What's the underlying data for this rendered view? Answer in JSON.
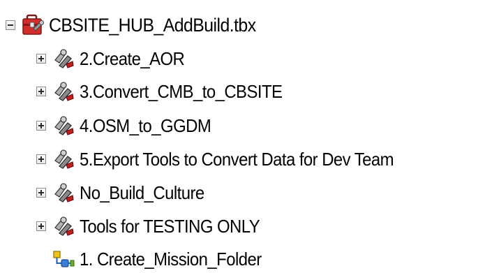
{
  "toolbox": {
    "name": "CBSITE_HUB_AddBuild.tbx",
    "expanded": true,
    "icon": "toolbox-icon"
  },
  "items": [
    {
      "label": "2.Create_AOR",
      "type": "toolset",
      "icon": "toolset-icon",
      "expander": "plus"
    },
    {
      "label": "3.Convert_CMB_to_CBSITE",
      "type": "toolset",
      "icon": "toolset-icon",
      "expander": "plus"
    },
    {
      "label": "4.OSM_to_GGDM",
      "type": "toolset",
      "icon": "toolset-icon",
      "expander": "plus"
    },
    {
      "label": "5.Export Tools to Convert Data for Dev Team",
      "type": "toolset",
      "icon": "toolset-icon",
      "expander": "plus"
    },
    {
      "label": "No_Build_Culture",
      "type": "toolset",
      "icon": "toolset-icon",
      "expander": "plus"
    },
    {
      "label": "Tools for TESTING ONLY",
      "type": "toolset",
      "icon": "toolset-icon",
      "expander": "plus"
    },
    {
      "label": "1. Create_Mission_Folder",
      "type": "model",
      "icon": "model-tool-icon",
      "expander": "none"
    }
  ]
}
